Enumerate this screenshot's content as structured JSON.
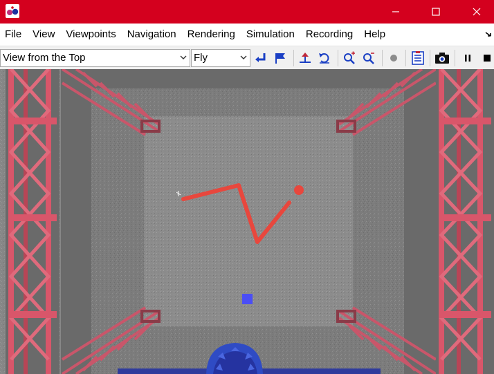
{
  "window": {
    "title_bar_color": "#d4001e",
    "controls": [
      "minimize-icon",
      "maximize-icon",
      "close-icon"
    ]
  },
  "menu": {
    "items": [
      "File",
      "View",
      "Viewpoints",
      "Navigation",
      "Rendering",
      "Simulation",
      "Recording",
      "Help"
    ]
  },
  "toolbar": {
    "viewpoint": "View from the Top",
    "navigation_mode": "Fly",
    "icons": [
      "go-to-viewpoint-icon",
      "flag-icon",
      "straighten-up-icon",
      "undo-move-icon",
      "zoom-in-icon",
      "zoom-out-icon",
      "record-icon",
      "properties-icon",
      "camera-icon",
      "pause-icon",
      "stop-icon"
    ]
  },
  "scene": {
    "floor_color": "#7d7d7d",
    "robot_arm_color": "#e8473d",
    "target_color": "#4b4ef5",
    "truss_color": "#d9566a",
    "base_color": "#2f3b9c"
  }
}
